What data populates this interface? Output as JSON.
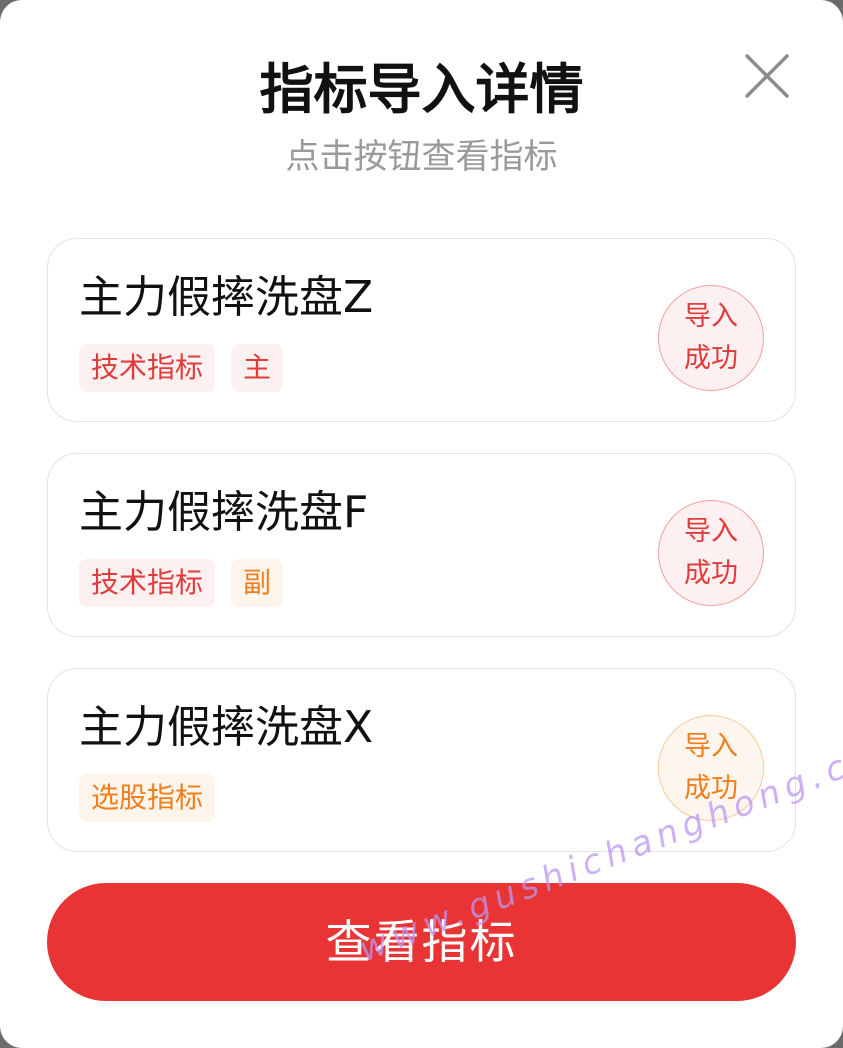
{
  "modal": {
    "title": "指标导入详情",
    "subtitle": "点击按钮查看指标",
    "close_icon": "close-icon"
  },
  "items": [
    {
      "name": "主力假摔洗盘Z",
      "tags": [
        {
          "label": "技术指标",
          "color": "#e03a3a"
        },
        {
          "label": "主",
          "color": "#e03a3a"
        }
      ],
      "status_line1": "导入",
      "status_line2": "成功",
      "status_color": "#e03a3a"
    },
    {
      "name": "主力假摔洗盘F",
      "tags": [
        {
          "label": "技术指标",
          "color": "#e03a3a"
        },
        {
          "label": "副",
          "color": "#f07e1a"
        }
      ],
      "status_line1": "导入",
      "status_line2": "成功",
      "status_color": "#e03a3a"
    },
    {
      "name": "主力假摔洗盘X",
      "tags": [
        {
          "label": "选股指标",
          "color": "#f07e1a"
        }
      ],
      "status_line1": "导入",
      "status_line2": "成功",
      "status_color": "#f07e1a"
    }
  ],
  "action": {
    "label": "查看指标",
    "color": "#e83434"
  },
  "watermark": "www.gushichanghong.com"
}
